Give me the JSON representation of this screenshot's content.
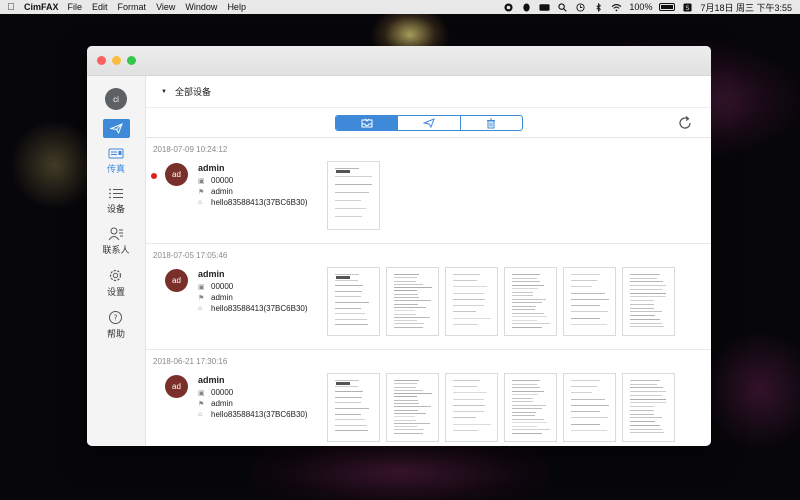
{
  "menubar": {
    "app_name": "CimFAX",
    "items": [
      "File",
      "Edit",
      "Format",
      "View",
      "Window",
      "Help"
    ],
    "battery": "100%",
    "datetime": "7月18日 周三 下午3:55"
  },
  "sidebar": {
    "user_initials": "ci",
    "items": [
      {
        "label": "传真",
        "icon": "fax-icon",
        "active": true
      },
      {
        "label": "设备",
        "icon": "list-icon"
      },
      {
        "label": "联系人",
        "icon": "contacts-icon"
      },
      {
        "label": "设置",
        "icon": "gear-icon"
      },
      {
        "label": "帮助",
        "icon": "help-icon"
      }
    ]
  },
  "filter": {
    "label": "全部设备"
  },
  "toolbar": {
    "segments": [
      "inbox-icon",
      "send-icon",
      "trash-icon"
    ],
    "selected": 0
  },
  "records": [
    {
      "date": "2018-07-09 10:24:12",
      "unread": true,
      "initials": "ad",
      "name": "admin",
      "number": "00000",
      "sender": "admin",
      "device": "hello83588413(37BC6B30)",
      "pages": 1
    },
    {
      "date": "2018-07-05 17:05:46",
      "unread": false,
      "initials": "ad",
      "name": "admin",
      "number": "00000",
      "sender": "admin",
      "device": "hello83588413(37BC6B30)",
      "pages": 6
    },
    {
      "date": "2018-06-21 17:30:16",
      "unread": false,
      "initials": "ad",
      "name": "admin",
      "number": "00000",
      "sender": "admin",
      "device": "hello83588413(37BC6B30)",
      "pages": 6
    }
  ],
  "colors": {
    "accent": "#3f8ad8",
    "avatar": "#7a2f2a",
    "unread": "#e21d1d"
  }
}
